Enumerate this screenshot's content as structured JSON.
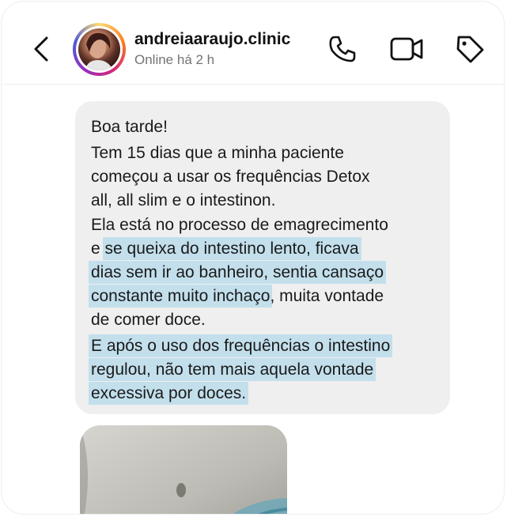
{
  "header": {
    "username": "andreiaaraujo.clinic",
    "status": "Online há 2 h",
    "back_icon": "chevron-left-icon",
    "call_icon": "phone-icon",
    "video_icon": "video-camera-icon",
    "tag_icon": "tag-icon"
  },
  "message": {
    "greeting": "Boa tarde!",
    "p1": [
      "Tem 15 dias que a minha paciente",
      "começou a usar os frequências Detox",
      "all, all slim e o intestinon."
    ],
    "p2": {
      "l1": "Ela está no processo de emagrecimento",
      "l2_a": "e ",
      "l2_b": "se queixa do intestino lento, ficava",
      "l3": "dias sem ir ao banheiro, sentia cansaço",
      "l4_a": "constante muito inchaço",
      "l4_b": ", muita vontade",
      "l5": "de comer doce."
    },
    "p3": [
      "E após o uso dos frequências o intestino",
      "regulou, não tem mais aquela vontade",
      "excessiva por doces."
    ]
  },
  "colors": {
    "highlight": "#c3dfec",
    "bubble": "#efefef",
    "status_text": "#737373"
  }
}
